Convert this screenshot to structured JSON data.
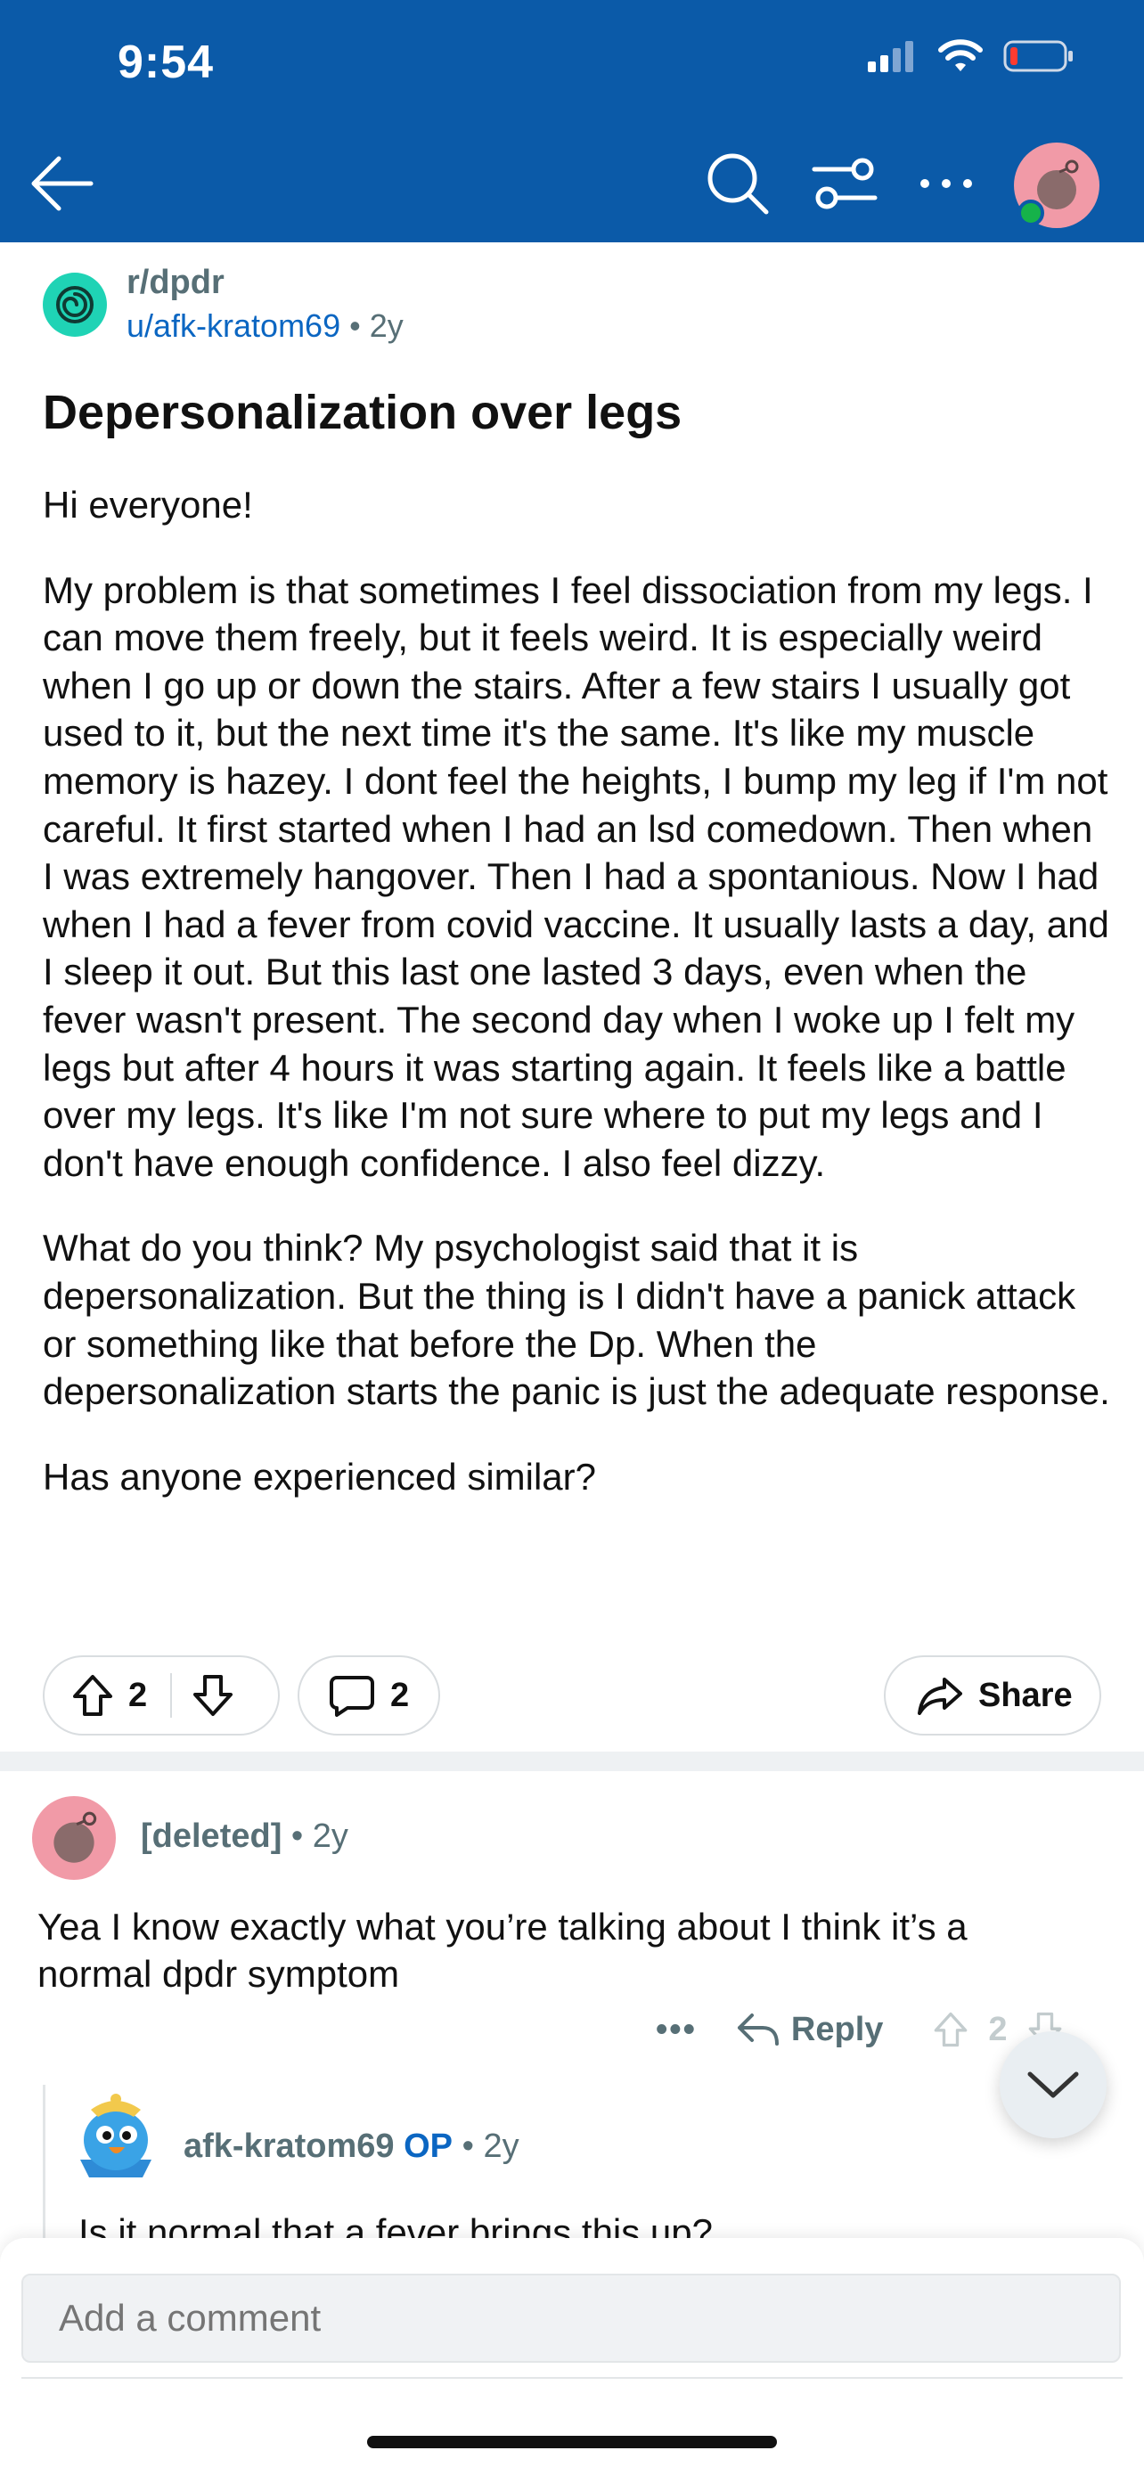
{
  "status_bar": {
    "time": "9:54"
  },
  "post": {
    "subreddit": "r/dpdr",
    "author": "u/afk-kratom69",
    "age": "2y",
    "title": "Depersonalization over legs",
    "paragraphs": [
      "Hi everyone!",
      "My problem is that sometimes I feel dissociation from my legs. I can move them freely, but it feels weird. It is especially weird when I go up or down the stairs. After a few stairs I usually got used to it, but the next time it's the same. It's like my muscle memory is hazey. I dont feel the heights, I bump my leg if I'm not careful. It first started when I had an lsd comedown. Then when I was extremely hangover. Then I had a spontanious. Now I had when I had a fever from covid vaccine. It usually lasts a day, and I sleep it out. But this last one lasted 3 days, even when the fever wasn't present. The second day when I woke up I felt my legs but after 4 hours it was starting again. It feels like a battle over my legs. It's like I'm not sure where to put my legs and I don't have enough confidence. I also feel dizzy.",
      "What do you think? My psychologist said that it is depersonalization. But the thing is I didn't have a panick attack or something like that before the Dp. When the depersonalization starts the panic is just the adequate response.",
      "Has anyone experienced similar?"
    ],
    "votes": "2",
    "comments": "2",
    "share_label": "Share"
  },
  "comment1": {
    "author": "[deleted]",
    "age": "2y",
    "text": "Yea I know exactly what you’re talking about I think it’s a normal dpdr symptom",
    "more": "•••",
    "reply_label": "Reply",
    "votes": "2"
  },
  "comment2": {
    "author": "afk-kratom69",
    "op_badge": "OP",
    "age": "2y",
    "text": "Is it normal that a fever brings this up?"
  },
  "composer": {
    "placeholder": "Add a comment"
  },
  "colors": {
    "header": "#0b5aa8",
    "link": "#0b66c2",
    "subreddit_icon": "#1fd3b5",
    "avatar": "#f19aa7"
  }
}
